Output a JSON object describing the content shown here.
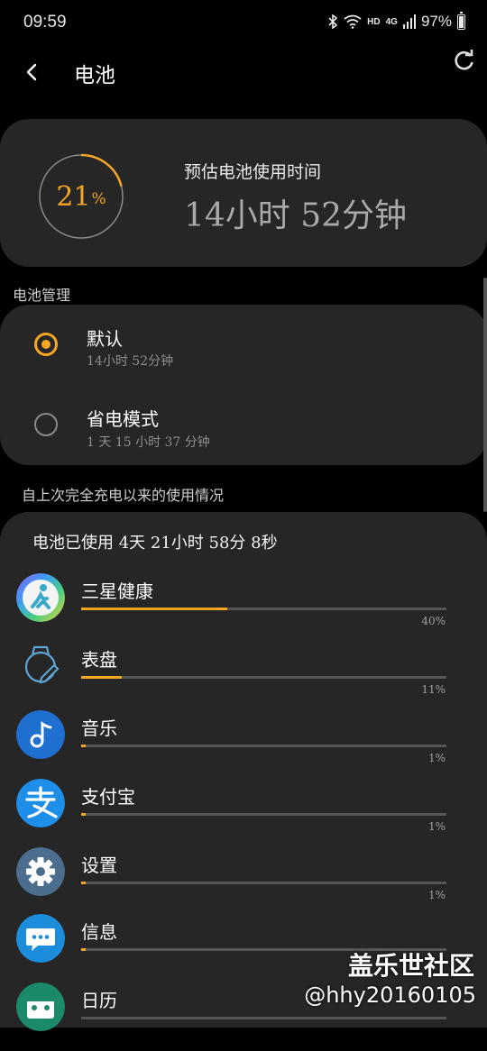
{
  "status_bar": {
    "time": "09:59",
    "hd": "HD",
    "network": "4G",
    "battery": "97%"
  },
  "header": {
    "title": "电池"
  },
  "estimate": {
    "percent": "21",
    "percent_sign": "%",
    "percent_value": 21,
    "label": "预估电池使用时间",
    "value": "14小时 52分钟"
  },
  "battery_management": {
    "section_label": "电池管理",
    "modes": [
      {
        "title": "默认",
        "subtitle": "14小时 52分钟",
        "selected": true
      },
      {
        "title": "省电模式",
        "subtitle": "1 天 15 小时 37 分钟",
        "selected": false
      }
    ]
  },
  "usage": {
    "section_label": "自上次完全充电以来的使用情况",
    "total": "电池已使用 4天 21小时 58分 8秒",
    "apps": [
      {
        "name": "三星健康",
        "percent": "40%",
        "value": 40,
        "icon": "samsung-health-icon"
      },
      {
        "name": "表盘",
        "percent": "11%",
        "value": 11,
        "icon": "watch-face-icon"
      },
      {
        "name": "音乐",
        "percent": "1%",
        "value": 1,
        "icon": "music-icon"
      },
      {
        "name": "支付宝",
        "percent": "1%",
        "value": 1,
        "icon": "alipay-icon"
      },
      {
        "name": "设置",
        "percent": "1%",
        "value": 1,
        "icon": "settings-gear-icon"
      },
      {
        "name": "信息",
        "percent": "",
        "value": 1,
        "icon": "messages-icon"
      },
      {
        "name": "日历",
        "percent": "",
        "value": 0,
        "icon": "calendar-icon"
      }
    ]
  },
  "watermark": {
    "title": "盖乐世社区",
    "user": "@hhy20160105"
  },
  "colors": {
    "accent": "#f5a623",
    "card": "#262626",
    "background": "#000000"
  }
}
